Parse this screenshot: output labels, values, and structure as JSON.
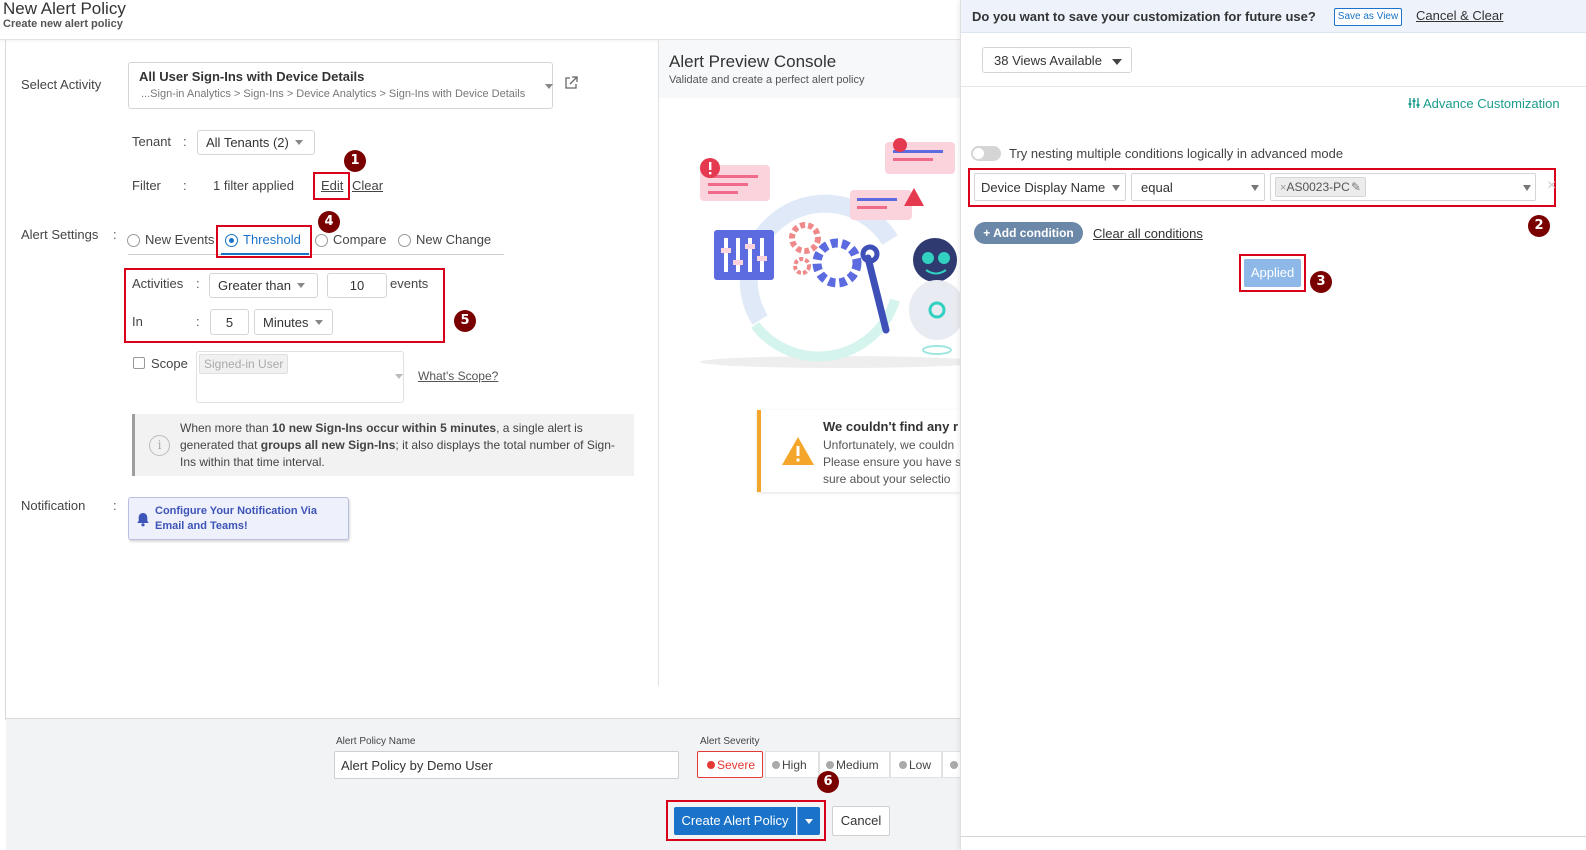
{
  "header": {
    "title": "New Alert Policy",
    "subtitle": "Create new alert policy"
  },
  "activity": {
    "label": "Select Activity",
    "name": "All User Sign-Ins with Device Details",
    "path": "...Sign-in Analytics > Sign-Ins > Device Analytics > Sign-Ins with Device Details"
  },
  "tenant": {
    "label": "Tenant",
    "value": "All Tenants (2)"
  },
  "filter": {
    "label": "Filter",
    "count": "1",
    "applied_text": "filter applied",
    "edit": "Edit",
    "clear": "Clear"
  },
  "alert_settings": {
    "label": "Alert Settings",
    "options": [
      "New Events",
      "Threshold",
      "Compare",
      "New Change"
    ],
    "selected": "Threshold"
  },
  "threshold": {
    "activities_label": "Activities",
    "operator": "Greater than",
    "count": "10",
    "events_label": "events",
    "in_label": "In",
    "window": "5",
    "unit": "Minutes"
  },
  "scope": {
    "label": "Scope",
    "value": "Signed-in User",
    "help_link": "What's Scope?"
  },
  "info": {
    "t1": "When more than ",
    "b1": "10 new Sign-Ins occur within 5 minutes",
    "t2": ", a single alert is generated that ",
    "b2": "groups all new Sign-Ins",
    "t3": "; it also displays the total number of Sign-Ins within that time interval."
  },
  "notification": {
    "label": "Notification",
    "button": "Configure Your Notification Via Email and Teams!"
  },
  "preview": {
    "title": "Alert Preview Console",
    "subtitle": "Validate and create a perfect alert policy",
    "warning_title": "We couldn't find any r",
    "warning_l1": "Unfortunately, we couldn",
    "warning_l2": "Please ensure you have s",
    "warning_l3": "sure about your selectio"
  },
  "footer": {
    "policy_name_label": "Alert Policy Name",
    "policy_name_value": "Alert Policy by Demo User",
    "severity_label": "Alert Severity",
    "severities": [
      "Severe",
      "High",
      "Medium",
      "Low"
    ],
    "create_button": "Create Alert Policy",
    "cancel_button": "Cancel"
  },
  "right_panel": {
    "save_question": "Do you want to save your customization for future use?",
    "save_as_view": "Save as View",
    "cancel_clear": "Cancel & Clear",
    "views_available": "38 Views Available",
    "advance_customization": "Advance Customization",
    "nesting_text": "Try nesting multiple conditions logically in advanced mode",
    "condition": {
      "field": "Device Display Name",
      "operator": "equal",
      "value": "AS0023-PC"
    },
    "add_condition": "+ Add condition",
    "clear_all": "Clear all conditions",
    "applied": "Applied"
  },
  "steps": [
    "1",
    "2",
    "3",
    "4",
    "5",
    "6"
  ],
  "colors": {
    "accent": "#1a73c8",
    "highlight": "#d9001b",
    "badge": "#7a0000",
    "severe": "#e53935",
    "teal": "#1a9c8c"
  }
}
